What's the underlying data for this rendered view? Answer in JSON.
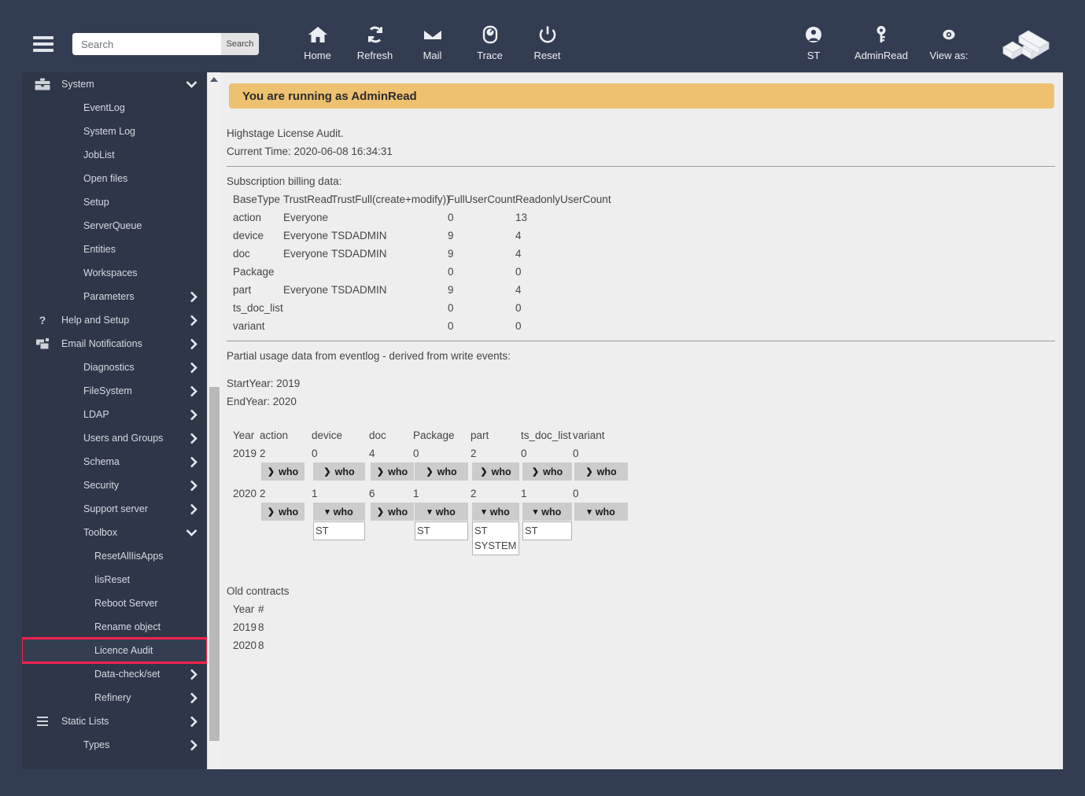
{
  "header": {
    "search": {
      "value": "",
      "placeholder": "Search",
      "button_label": "Search"
    },
    "nav": [
      {
        "label": "Home",
        "icon": "home-icon"
      },
      {
        "label": "Refresh",
        "icon": "refresh-icon"
      },
      {
        "label": "Mail",
        "icon": "mail-icon"
      },
      {
        "label": "Trace",
        "icon": "trace-icon"
      },
      {
        "label": "Reset",
        "icon": "power-icon"
      }
    ],
    "right_nav": [
      {
        "label": "ST",
        "icon": "user-icon"
      },
      {
        "label": "AdminRead",
        "icon": "key-icon"
      },
      {
        "label": "View as:",
        "icon": "eye-icon"
      }
    ],
    "logo_name": "highstage-cube-logo"
  },
  "sidebar": {
    "items": [
      {
        "label": "System",
        "level": 1,
        "icon": "toolbox-icon",
        "arrow": "down",
        "selected": false
      },
      {
        "label": "EventLog",
        "level": 2,
        "icon": "",
        "arrow": "",
        "selected": false
      },
      {
        "label": "System Log",
        "level": 2,
        "icon": "",
        "arrow": "",
        "selected": false
      },
      {
        "label": "JobList",
        "level": 2,
        "icon": "",
        "arrow": "",
        "selected": false
      },
      {
        "label": "Open files",
        "level": 2,
        "icon": "",
        "arrow": "",
        "selected": false
      },
      {
        "label": "Setup",
        "level": 2,
        "icon": "",
        "arrow": "",
        "selected": false
      },
      {
        "label": "ServerQueue",
        "level": 2,
        "icon": "",
        "arrow": "",
        "selected": false
      },
      {
        "label": "Entities",
        "level": 2,
        "icon": "",
        "arrow": "",
        "selected": false
      },
      {
        "label": "Workspaces",
        "level": 2,
        "icon": "",
        "arrow": "",
        "selected": false
      },
      {
        "label": "Parameters",
        "level": 2,
        "icon": "",
        "arrow": "right",
        "selected": false
      },
      {
        "label": "Help and Setup",
        "level": 1,
        "icon": "question-icon",
        "arrow": "right",
        "selected": false
      },
      {
        "label": "Email Notifications",
        "level": 1,
        "icon": "email-notification-icon",
        "arrow": "right",
        "selected": false
      },
      {
        "label": "Diagnostics",
        "level": 2,
        "icon": "",
        "arrow": "right",
        "selected": false
      },
      {
        "label": "FileSystem",
        "level": 2,
        "icon": "",
        "arrow": "right",
        "selected": false
      },
      {
        "label": "LDAP",
        "level": 2,
        "icon": "",
        "arrow": "right",
        "selected": false
      },
      {
        "label": "Users and Groups",
        "level": 2,
        "icon": "",
        "arrow": "right",
        "selected": false
      },
      {
        "label": "Schema",
        "level": 2,
        "icon": "",
        "arrow": "right",
        "selected": false
      },
      {
        "label": "Security",
        "level": 2,
        "icon": "",
        "arrow": "right",
        "selected": false
      },
      {
        "label": "Support server",
        "level": 2,
        "icon": "",
        "arrow": "right",
        "selected": false
      },
      {
        "label": "Toolbox",
        "level": 2,
        "icon": "",
        "arrow": "down",
        "selected": false
      },
      {
        "label": "ResetAllIisApps",
        "level": 3,
        "icon": "",
        "arrow": "",
        "selected": false
      },
      {
        "label": "IisReset",
        "level": 3,
        "icon": "",
        "arrow": "",
        "selected": false
      },
      {
        "label": "Reboot Server",
        "level": 3,
        "icon": "",
        "arrow": "",
        "selected": false
      },
      {
        "label": "Rename object",
        "level": 3,
        "icon": "",
        "arrow": "",
        "selected": false
      },
      {
        "label": "Licence Audit",
        "level": 3,
        "icon": "",
        "arrow": "",
        "selected": true
      },
      {
        "label": "Data-check/set",
        "level": 3,
        "icon": "",
        "arrow": "right",
        "selected": false
      },
      {
        "label": "Refinery",
        "level": 3,
        "icon": "",
        "arrow": "right",
        "selected": false
      },
      {
        "label": "Static Lists",
        "level": 1,
        "icon": "list-icon",
        "arrow": "right",
        "selected": false
      },
      {
        "label": "Types",
        "level": 2,
        "icon": "",
        "arrow": "right",
        "selected": false
      }
    ]
  },
  "main": {
    "banner": "You are running as AdminRead",
    "title_line": "Highstage License Audit.",
    "current_time_line": "Current Time: 2020-06-08 16:34:31",
    "billing": {
      "heading": "Subscription billing data:",
      "columns": [
        "BaseType",
        "TrustRead",
        "TrustFull(create+modify))",
        "FullUserCount",
        "ReadonlyUserCount"
      ],
      "rows": [
        [
          "action",
          "Everyone",
          "",
          "0",
          "13"
        ],
        [
          "device",
          "Everyone",
          "TSDADMIN",
          "9",
          "4"
        ],
        [
          "doc",
          "Everyone",
          "TSDADMIN",
          "9",
          "4"
        ],
        [
          "Package",
          "",
          "",
          "0",
          "0"
        ],
        [
          "part",
          "Everyone",
          "TSDADMIN",
          "9",
          "4"
        ],
        [
          "ts_doc_list",
          "",
          "",
          "0",
          "0"
        ],
        [
          "variant",
          "",
          "",
          "0",
          "0"
        ]
      ]
    },
    "usage": {
      "heading": "Partial usage data from eventlog - derived from write events:",
      "start_year_label": "StartYear: 2019",
      "end_year_label": "EndYear: 2020",
      "columns": [
        "Year",
        "action",
        "device",
        "doc",
        "Package",
        "part",
        "ts_doc_list",
        "variant"
      ],
      "who_label": "who",
      "rows": [
        {
          "year": "2019",
          "counts": [
            "2",
            "0",
            "4",
            "0",
            "2",
            "0",
            "0"
          ],
          "expanded": [
            false,
            false,
            false,
            false,
            false,
            false,
            false
          ],
          "who": [
            [],
            [],
            [],
            [],
            [],
            [],
            []
          ]
        },
        {
          "year": "2020",
          "counts": [
            "2",
            "1",
            "6",
            "1",
            "2",
            "1",
            "0"
          ],
          "expanded": [
            false,
            true,
            false,
            true,
            true,
            true,
            true
          ],
          "who": [
            [],
            [
              "ST"
            ],
            [],
            [
              "ST"
            ],
            [
              "ST",
              "SYSTEM"
            ],
            [
              "ST"
            ],
            []
          ]
        }
      ]
    },
    "old_contracts": {
      "heading": "Old contracts",
      "columns": [
        "Year",
        "#"
      ],
      "rows": [
        [
          "2019",
          "8"
        ],
        [
          "2020",
          "8"
        ]
      ]
    }
  },
  "colors": {
    "chrome": "#333d51",
    "sidebar": "#2e3748",
    "content_bg": "#eeeeee",
    "banner": "#eec170",
    "selection_outline": "#f5224f",
    "button_grey": "#cccccc"
  }
}
